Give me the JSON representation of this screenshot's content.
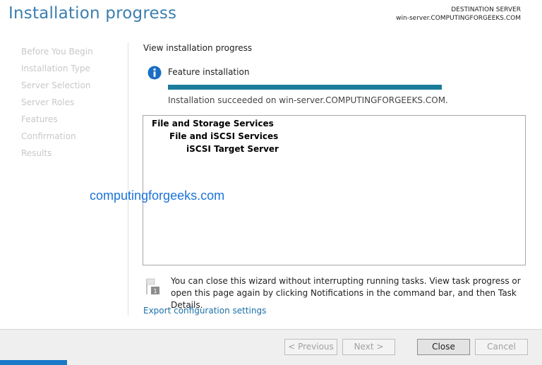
{
  "window": {
    "title": "Installation progress",
    "destination_label": "DESTINATION SERVER",
    "destination_server": "win-server.COMPUTINGFORGEEKS.COM"
  },
  "nav": {
    "items": [
      {
        "label": "Before You Begin"
      },
      {
        "label": "Installation Type"
      },
      {
        "label": "Server Selection"
      },
      {
        "label": "Server Roles"
      },
      {
        "label": "Features"
      },
      {
        "label": "Confirmation"
      },
      {
        "label": "Results"
      }
    ],
    "active_index": 6
  },
  "main": {
    "section_title": "View installation progress",
    "feature_label": "Feature installation",
    "progress_percent": 100,
    "status_text": "Installation succeeded on win-server.COMPUTINGFORGEEKS.COM.",
    "results": [
      {
        "label": "File and Storage Services",
        "level": 0
      },
      {
        "label": "File and iSCSI Services",
        "level": 1
      },
      {
        "label": "iSCSI Target Server",
        "level": 2
      }
    ],
    "watermark": "computingforgeeks.com",
    "note": "You can close this wizard without interrupting running tasks. View task progress or open this page again by clicking Notifications in the command bar, and then Task Details.",
    "note_icon_number": "1",
    "export_link": "Export configuration settings"
  },
  "footer": {
    "previous_label": "< Previous",
    "next_label": "Next >",
    "close_label": "Close",
    "cancel_label": "Cancel"
  },
  "icons": {
    "info": "info-icon",
    "note": "flag-note-icon"
  },
  "colors": {
    "accent": "#1879c6",
    "title": "#3b7fb0",
    "progress": "#1b7b9a",
    "link": "#1a6fa8"
  }
}
